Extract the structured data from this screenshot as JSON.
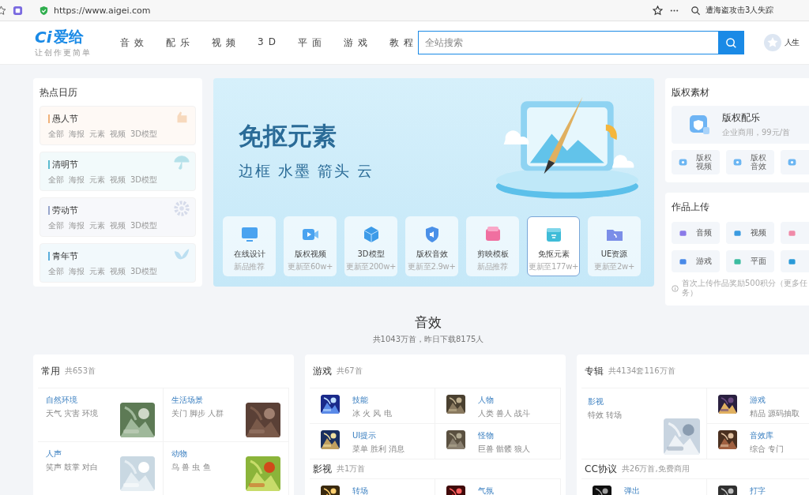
{
  "browser": {
    "url": "https://www.aigei.com",
    "search": "遭海盗攻击3人失踪"
  },
  "header": {
    "logo": "Ci",
    "brand": "爱给",
    "tagline": "让创作更简单",
    "nav": [
      {
        "label": "音效"
      },
      {
        "label": "配乐"
      },
      {
        "label": "视频"
      },
      {
        "label": "3D"
      },
      {
        "label": "平面"
      },
      {
        "label": "游戏"
      },
      {
        "label": "教程"
      }
    ],
    "search_placeholder": "全站搜索",
    "user": "人生"
  },
  "calendar": {
    "title": "热点日历",
    "items": [
      {
        "name": "愚人节",
        "color": "#f0b27a",
        "tags": [
          "全部",
          "海报",
          "元素",
          "视频",
          "3D模型"
        ]
      },
      {
        "name": "清明节",
        "color": "#5bbcd0",
        "tags": [
          "全部",
          "海报",
          "元素",
          "视频",
          "3D模型"
        ]
      },
      {
        "name": "劳动节",
        "color": "#98a6cc",
        "tags": [
          "全部",
          "海报",
          "元素",
          "视频",
          "3D模型"
        ]
      },
      {
        "name": "青年节",
        "color": "#5aaedc",
        "tags": [
          "全部",
          "海报",
          "元素",
          "视频",
          "3D模型"
        ]
      }
    ]
  },
  "banner": {
    "title": "免抠元素",
    "subtitle": "边框 水墨 箭头 云",
    "tiles": [
      {
        "label": "在线设计",
        "sub": "新品推荐",
        "selected": false
      },
      {
        "label": "版权视频",
        "sub": "更新至60w+",
        "selected": false
      },
      {
        "label": "3D模型",
        "sub": "更新至200w+",
        "selected": false
      },
      {
        "label": "版权音效",
        "sub": "更新至2.9w+",
        "selected": false
      },
      {
        "label": "剪映模板",
        "sub": "新品推荐",
        "selected": false
      },
      {
        "label": "免抠元素",
        "sub": "更新至177w+",
        "selected": true
      },
      {
        "label": "UE资源",
        "sub": "更新至2w+",
        "selected": false
      }
    ]
  },
  "copyright": {
    "title": "版权素材",
    "featured": {
      "title": "版权配乐",
      "sub": "企业商用，99元/首"
    },
    "tiles": [
      {
        "kind": "labeled",
        "label": "版权视频"
      },
      {
        "kind": "labeled",
        "label": "版权音效"
      },
      {
        "kind": "partial"
      }
    ]
  },
  "upload": {
    "title": "作品上传",
    "tiles": [
      {
        "kind": "labeled",
        "label": "音频"
      },
      {
        "kind": "labeled",
        "label": "视频"
      },
      {
        "kind": "partial"
      },
      {
        "kind": "labeled",
        "label": "游戏"
      },
      {
        "kind": "labeled",
        "label": "平面"
      },
      {
        "kind": "partial"
      }
    ],
    "note": "首次上传作品奖励500积分（更多任务）"
  },
  "section": {
    "title": "音效",
    "subtitle": "共1043万首，昨日下载8175人"
  },
  "cards": [
    {
      "kind": "thumb-grid",
      "sections": [
        {
          "title": "常用",
          "count": "共653首",
          "items": [
            {
              "name": "自然环境",
              "tags": "天气 灾害 环境"
            },
            {
              "name": "生活场景",
              "tags": "关门 脚步 人群"
            },
            {
              "name": "人声",
              "tags": "笑声 鼓掌 对白"
            },
            {
              "name": "动物",
              "tags": "鸟 兽 虫 鱼"
            }
          ]
        }
      ]
    },
    {
      "kind": "icon-list",
      "sections": [
        {
          "title": "游戏",
          "count": "共67首",
          "items": [
            {
              "name": "技能",
              "tags": "冰 火 风 电"
            },
            {
              "name": "人物",
              "tags": "人类 兽人 战斗"
            },
            {
              "name": "UI提示",
              "tags": "菜单 胜利 消息"
            },
            {
              "name": "怪物",
              "tags": "巨兽 骷髅 狼人"
            }
          ]
        },
        {
          "title": "影视",
          "count": "共1万首",
          "items": [
            {
              "name": "转场"
            },
            {
              "name": "气氛"
            }
          ]
        }
      ]
    },
    {
      "kind": "album",
      "sections": [
        {
          "title": "专辑",
          "count": "共4134套116万首",
          "items": [
            {
              "kind": "large",
              "name": "影视",
              "tags": "特效 转场"
            },
            {
              "kind": "small",
              "name": "游戏",
              "tags": "精品 源码抽取"
            },
            {
              "kind": "small",
              "name": "音效库",
              "tags": "综合 专门"
            }
          ]
        },
        {
          "title": "CC协议",
          "count": "共26万首,免费商用",
          "items": [
            {
              "kind": "small",
              "name": "弹出"
            },
            {
              "kind": "small",
              "name": "打字"
            }
          ]
        }
      ]
    }
  ]
}
